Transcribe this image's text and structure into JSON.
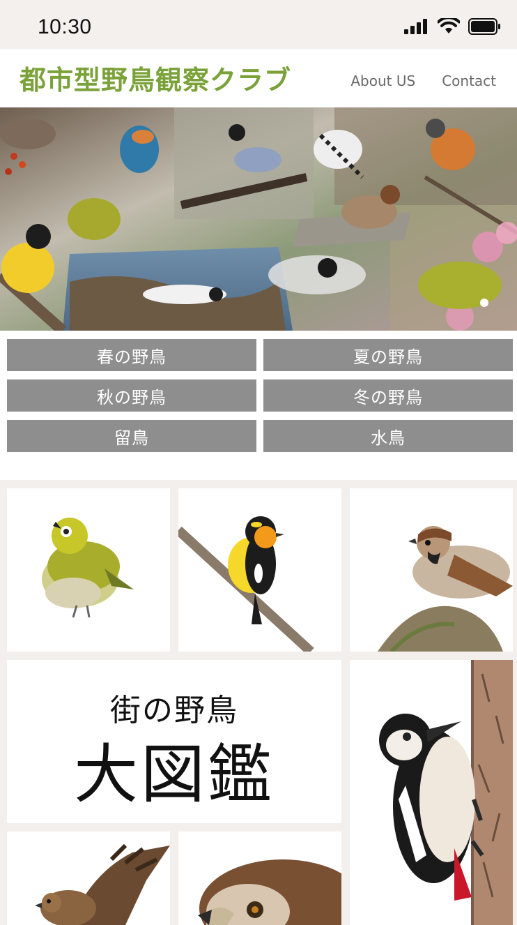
{
  "status_bar": {
    "time": "10:30",
    "icons": [
      "cellular-signal-icon",
      "wifi-icon",
      "battery-icon"
    ]
  },
  "header": {
    "site_title": "都市型野鳥観察クラブ",
    "nav": [
      {
        "label": "About US"
      },
      {
        "label": "Contact"
      }
    ],
    "brand_color": "#7aa239"
  },
  "hero": {
    "image": "bird-collage"
  },
  "categories": [
    {
      "label": "春の野鳥"
    },
    {
      "label": "夏の野鳥"
    },
    {
      "label": "秋の野鳥"
    },
    {
      "label": "冬の野鳥"
    },
    {
      "label": "留鳥"
    },
    {
      "label": "水鳥"
    }
  ],
  "category_button_color": "#8e8e8e",
  "gallery": {
    "photos": [
      "japanese-white-eye",
      "narcissus-flycatcher",
      "sparrow",
      "great-spotted-woodpecker",
      "hawk",
      "eagle"
    ],
    "feature": {
      "subtitle": "街の野鳥",
      "title": "大図鑑"
    }
  }
}
